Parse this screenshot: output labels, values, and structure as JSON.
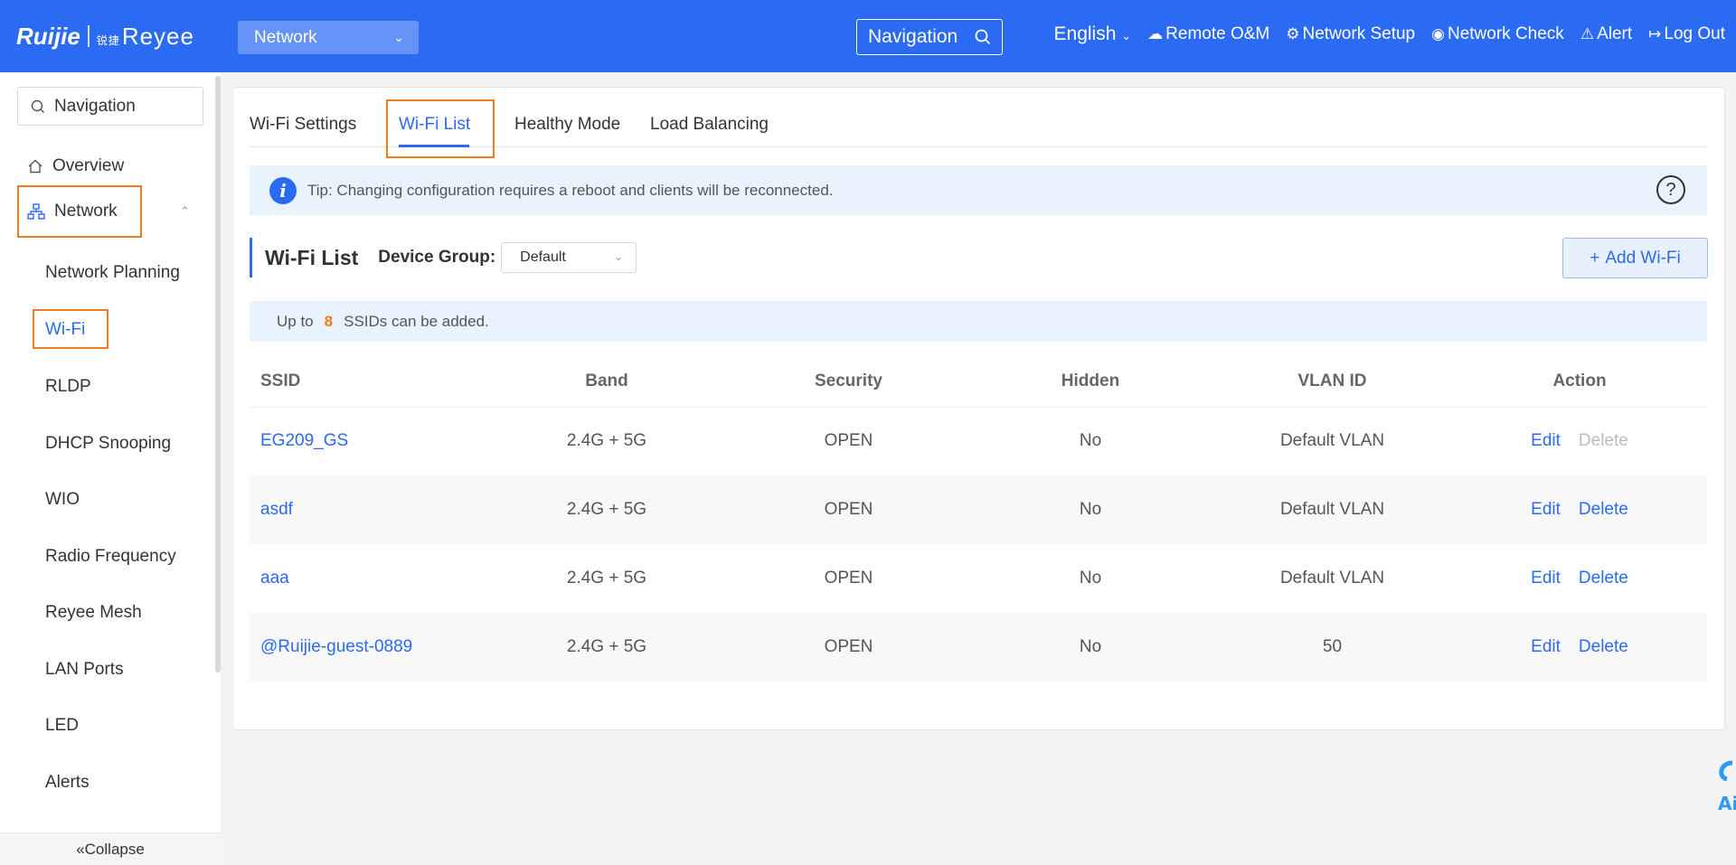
{
  "header": {
    "logo_brand": "Ruijie",
    "logo_sub_small": "锐捷",
    "logo_sub": "Reyee",
    "network_select": "Network",
    "navigation_button": "Navigation",
    "language": "English",
    "remote": "Remote O&M",
    "setup": "Network Setup",
    "check": "Network Check",
    "alert": "Alert",
    "logout": "Log Out"
  },
  "sidebar": {
    "search_placeholder": "Navigation",
    "overview": "Overview",
    "network": "Network",
    "sub_items": [
      "Network Planning",
      "Wi-Fi",
      "RLDP",
      "DHCP Snooping",
      "WIO",
      "Radio Frequency",
      "Reyee Mesh",
      "LAN Ports",
      "LED",
      "Alerts"
    ],
    "collapse": "Collapse"
  },
  "tabs": [
    "Wi-Fi Settings",
    "Wi-Fi List",
    "Healthy Mode",
    "Load Balancing"
  ],
  "tip": "Tip: Changing configuration requires a reboot and clients will be reconnected.",
  "section": {
    "title": "Wi-Fi List",
    "device_group_label": "Device Group:",
    "device_group_value": "Default",
    "add_button": "Add Wi-Fi"
  },
  "limit": {
    "prefix": "Up to",
    "count": "8",
    "suffix": "SSIDs can be added."
  },
  "table": {
    "headers": [
      "SSID",
      "Band",
      "Security",
      "Hidden",
      "VLAN ID",
      "Action"
    ],
    "edit_label": "Edit",
    "delete_label": "Delete",
    "rows": [
      {
        "ssid": "EG209_GS",
        "band": "2.4G + 5G",
        "security": "OPEN",
        "hidden": "No",
        "vlan": "Default VLAN",
        "delete_disabled": true
      },
      {
        "ssid": "asdf",
        "band": "2.4G + 5G",
        "security": "OPEN",
        "hidden": "No",
        "vlan": "Default VLAN",
        "delete_disabled": false
      },
      {
        "ssid": "aaa",
        "band": "2.4G + 5G",
        "security": "OPEN",
        "hidden": "No",
        "vlan": "Default VLAN",
        "delete_disabled": false
      },
      {
        "ssid": "@Ruijie-guest-0889",
        "band": "2.4G + 5G",
        "security": "OPEN",
        "hidden": "No",
        "vlan": "50",
        "delete_disabled": false
      }
    ]
  },
  "colors": {
    "primary": "#2b6af3",
    "highlight": "#f47a20"
  }
}
